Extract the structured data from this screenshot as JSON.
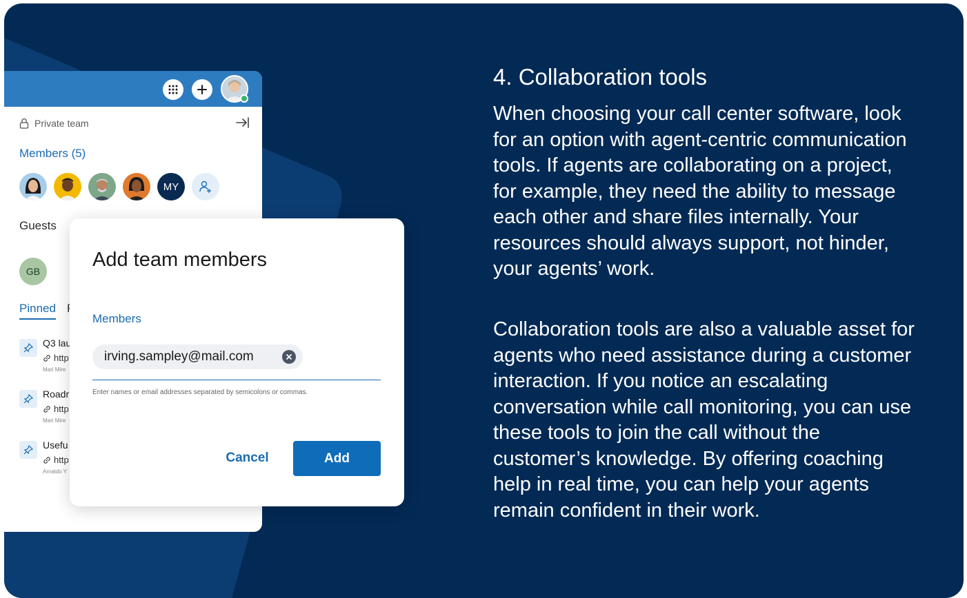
{
  "panel": {
    "private_label": "Private team",
    "members_label": "Members (5)",
    "member_initials": "MY",
    "guests_label": "Guests",
    "guest_initials": "GB",
    "tabs": [
      "Pinned",
      "F"
    ],
    "pinned_items": [
      {
        "title": "Q3 lau",
        "link": "http",
        "author": "Mari Mire"
      },
      {
        "title": "Roadr",
        "link": "http",
        "author": "Mari Mire"
      },
      {
        "title": "Usefu",
        "link": "http",
        "author": "Arnaldo Y"
      }
    ]
  },
  "dialog": {
    "title": "Add team members",
    "members_label": "Members",
    "chip_value": "irving.sampley@mail.com",
    "helper": "Enter names or email addresses separated by semicolons or commas.",
    "cancel_label": "Cancel",
    "add_label": "Add"
  },
  "article": {
    "heading": "4. Collaboration tools",
    "paragraph_1": "When choosing your call center software, look for an option with agent-centric communication tools. If agents are collaborating on a project, for example, they need the ability to message each other and share files internally. Your resources should always support, not hinder, your agents’ work.",
    "paragraph_2": "Collaboration tools are also a valuable asset for agents who need assistance during a customer interaction. If you notice an escalating conversation while call monitoring, you can use these tools to join the call without the customer’s knowledge. By offering coaching help in real time, you can help your agents remain confident in their work."
  },
  "colors": {
    "background": "#032a55",
    "accent": "#1a6bb3",
    "header": "#2e7cc0",
    "primary_button": "#0e6cb8"
  }
}
